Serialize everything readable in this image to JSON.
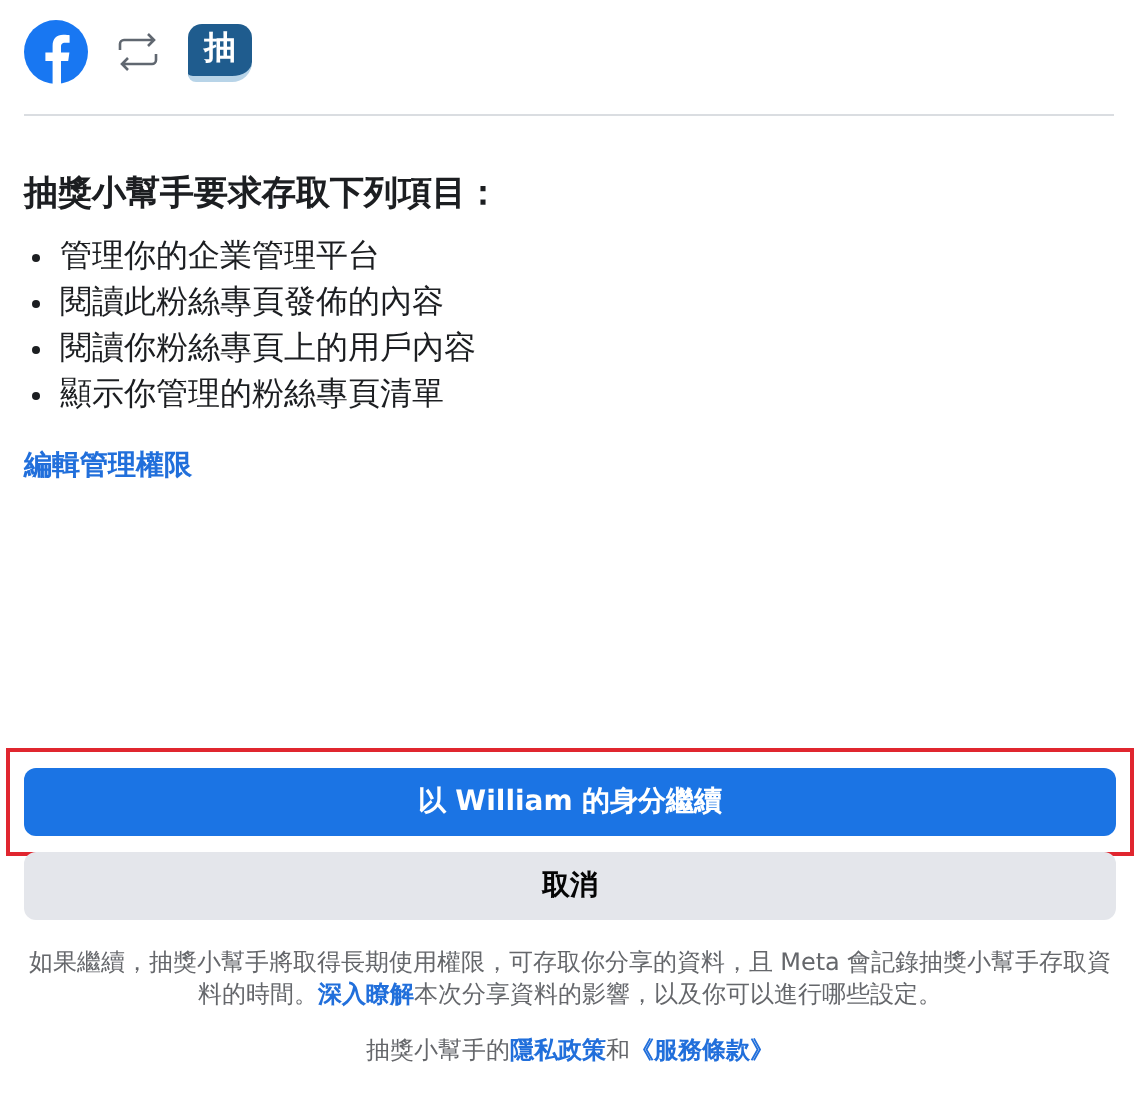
{
  "header": {
    "app_badge": "抽"
  },
  "title": "抽獎小幫手要求存取下列項目：",
  "permissions": [
    "管理你的企業管理平台",
    "閱讀此粉絲專頁發佈的內容",
    "閱讀你粉絲專頁上的用戶內容",
    "顯示你管理的粉絲專頁清單"
  ],
  "edit_link": "編輯管理權限",
  "continue_button": {
    "label": "以 William 的身分繼續",
    "highlighted": true
  },
  "cancel_button": "取消",
  "notice": [
    {
      "kind": "text",
      "text": "如果繼續，抽獎小幫手將取得長期使用權限，可存取你分享的資料，且 Meta 會記錄抽獎小幫手存取資料的時間。"
    },
    {
      "kind": "link",
      "text": "深入瞭解"
    },
    {
      "kind": "text",
      "text": "本次分享資料的影響，以及你可以進行哪些設定。"
    }
  ],
  "policy": [
    {
      "kind": "text",
      "text": "抽獎小幫手的"
    },
    {
      "kind": "link",
      "text": "隱私政策"
    },
    {
      "kind": "text",
      "text": "和"
    },
    {
      "kind": "link",
      "text": "《服務條款》"
    }
  ]
}
